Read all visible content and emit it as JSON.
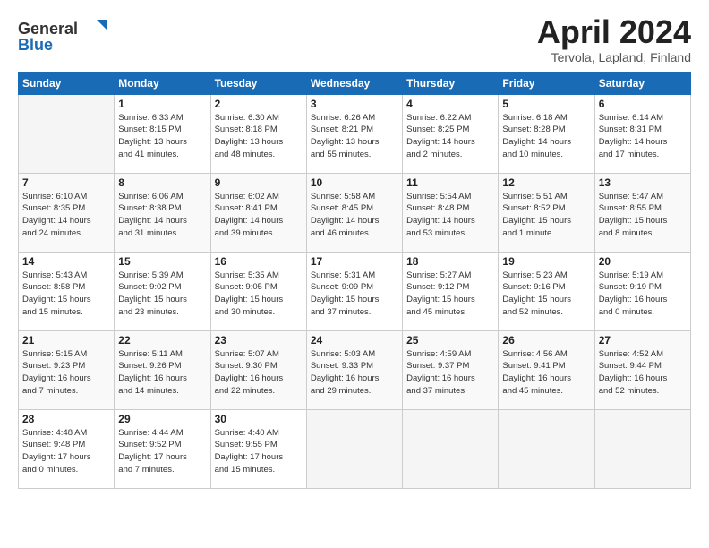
{
  "header": {
    "logo_general": "General",
    "logo_blue": "Blue",
    "month_title": "April 2024",
    "location": "Tervola, Lapland, Finland"
  },
  "days_of_week": [
    "Sunday",
    "Monday",
    "Tuesday",
    "Wednesday",
    "Thursday",
    "Friday",
    "Saturday"
  ],
  "weeks": [
    [
      {
        "day": "",
        "info": ""
      },
      {
        "day": "1",
        "info": "Sunrise: 6:33 AM\nSunset: 8:15 PM\nDaylight: 13 hours\nand 41 minutes."
      },
      {
        "day": "2",
        "info": "Sunrise: 6:30 AM\nSunset: 8:18 PM\nDaylight: 13 hours\nand 48 minutes."
      },
      {
        "day": "3",
        "info": "Sunrise: 6:26 AM\nSunset: 8:21 PM\nDaylight: 13 hours\nand 55 minutes."
      },
      {
        "day": "4",
        "info": "Sunrise: 6:22 AM\nSunset: 8:25 PM\nDaylight: 14 hours\nand 2 minutes."
      },
      {
        "day": "5",
        "info": "Sunrise: 6:18 AM\nSunset: 8:28 PM\nDaylight: 14 hours\nand 10 minutes."
      },
      {
        "day": "6",
        "info": "Sunrise: 6:14 AM\nSunset: 8:31 PM\nDaylight: 14 hours\nand 17 minutes."
      }
    ],
    [
      {
        "day": "7",
        "info": "Sunrise: 6:10 AM\nSunset: 8:35 PM\nDaylight: 14 hours\nand 24 minutes."
      },
      {
        "day": "8",
        "info": "Sunrise: 6:06 AM\nSunset: 8:38 PM\nDaylight: 14 hours\nand 31 minutes."
      },
      {
        "day": "9",
        "info": "Sunrise: 6:02 AM\nSunset: 8:41 PM\nDaylight: 14 hours\nand 39 minutes."
      },
      {
        "day": "10",
        "info": "Sunrise: 5:58 AM\nSunset: 8:45 PM\nDaylight: 14 hours\nand 46 minutes."
      },
      {
        "day": "11",
        "info": "Sunrise: 5:54 AM\nSunset: 8:48 PM\nDaylight: 14 hours\nand 53 minutes."
      },
      {
        "day": "12",
        "info": "Sunrise: 5:51 AM\nSunset: 8:52 PM\nDaylight: 15 hours\nand 1 minute."
      },
      {
        "day": "13",
        "info": "Sunrise: 5:47 AM\nSunset: 8:55 PM\nDaylight: 15 hours\nand 8 minutes."
      }
    ],
    [
      {
        "day": "14",
        "info": "Sunrise: 5:43 AM\nSunset: 8:58 PM\nDaylight: 15 hours\nand 15 minutes."
      },
      {
        "day": "15",
        "info": "Sunrise: 5:39 AM\nSunset: 9:02 PM\nDaylight: 15 hours\nand 23 minutes."
      },
      {
        "day": "16",
        "info": "Sunrise: 5:35 AM\nSunset: 9:05 PM\nDaylight: 15 hours\nand 30 minutes."
      },
      {
        "day": "17",
        "info": "Sunrise: 5:31 AM\nSunset: 9:09 PM\nDaylight: 15 hours\nand 37 minutes."
      },
      {
        "day": "18",
        "info": "Sunrise: 5:27 AM\nSunset: 9:12 PM\nDaylight: 15 hours\nand 45 minutes."
      },
      {
        "day": "19",
        "info": "Sunrise: 5:23 AM\nSunset: 9:16 PM\nDaylight: 15 hours\nand 52 minutes."
      },
      {
        "day": "20",
        "info": "Sunrise: 5:19 AM\nSunset: 9:19 PM\nDaylight: 16 hours\nand 0 minutes."
      }
    ],
    [
      {
        "day": "21",
        "info": "Sunrise: 5:15 AM\nSunset: 9:23 PM\nDaylight: 16 hours\nand 7 minutes."
      },
      {
        "day": "22",
        "info": "Sunrise: 5:11 AM\nSunset: 9:26 PM\nDaylight: 16 hours\nand 14 minutes."
      },
      {
        "day": "23",
        "info": "Sunrise: 5:07 AM\nSunset: 9:30 PM\nDaylight: 16 hours\nand 22 minutes."
      },
      {
        "day": "24",
        "info": "Sunrise: 5:03 AM\nSunset: 9:33 PM\nDaylight: 16 hours\nand 29 minutes."
      },
      {
        "day": "25",
        "info": "Sunrise: 4:59 AM\nSunset: 9:37 PM\nDaylight: 16 hours\nand 37 minutes."
      },
      {
        "day": "26",
        "info": "Sunrise: 4:56 AM\nSunset: 9:41 PM\nDaylight: 16 hours\nand 45 minutes."
      },
      {
        "day": "27",
        "info": "Sunrise: 4:52 AM\nSunset: 9:44 PM\nDaylight: 16 hours\nand 52 minutes."
      }
    ],
    [
      {
        "day": "28",
        "info": "Sunrise: 4:48 AM\nSunset: 9:48 PM\nDaylight: 17 hours\nand 0 minutes."
      },
      {
        "day": "29",
        "info": "Sunrise: 4:44 AM\nSunset: 9:52 PM\nDaylight: 17 hours\nand 7 minutes."
      },
      {
        "day": "30",
        "info": "Sunrise: 4:40 AM\nSunset: 9:55 PM\nDaylight: 17 hours\nand 15 minutes."
      },
      {
        "day": "",
        "info": ""
      },
      {
        "day": "",
        "info": ""
      },
      {
        "day": "",
        "info": ""
      },
      {
        "day": "",
        "info": ""
      }
    ]
  ]
}
